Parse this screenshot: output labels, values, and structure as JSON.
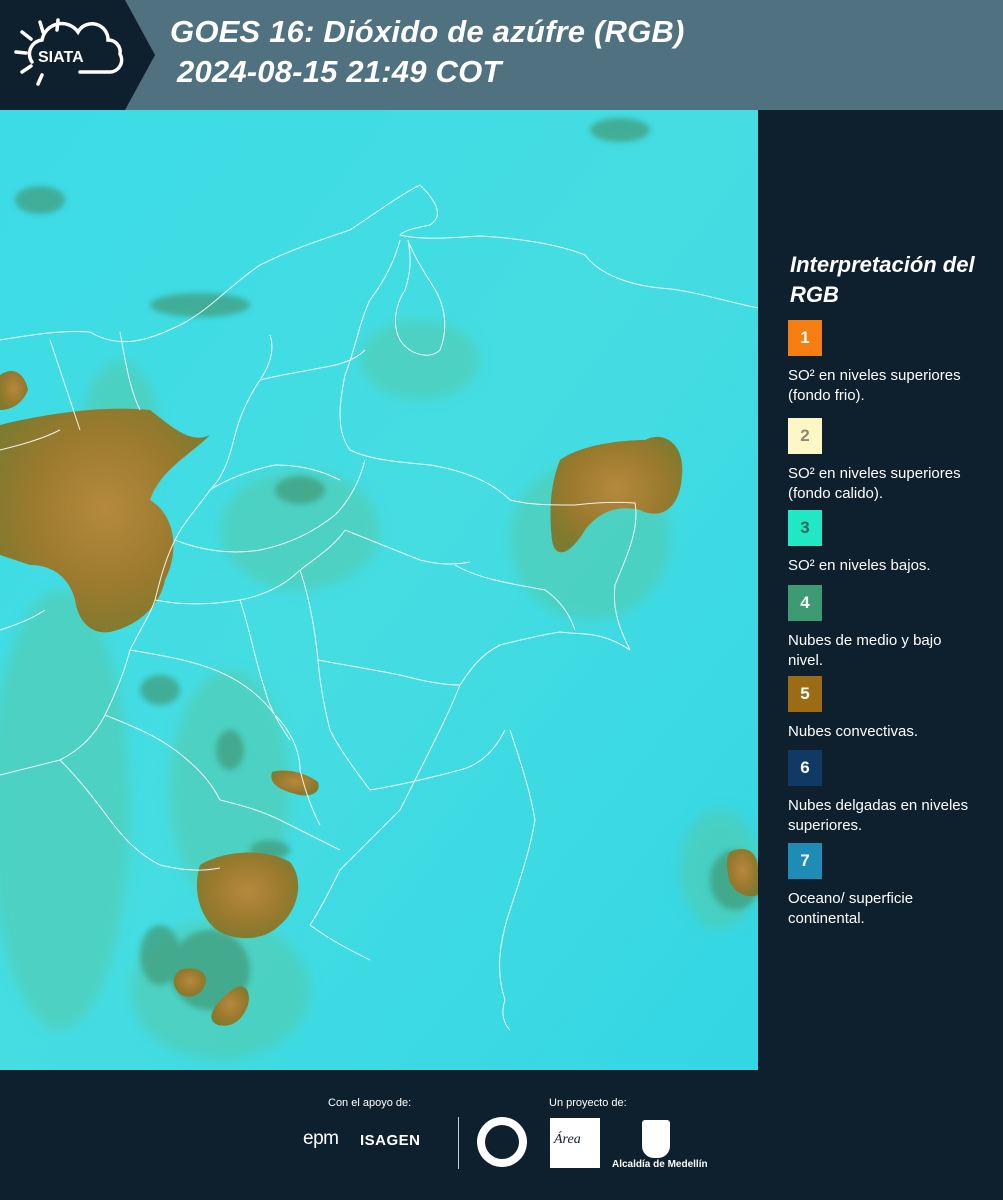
{
  "header": {
    "logo_text": "SIATA",
    "title": "GOES 16: Dióxido de azúfre (RGB)",
    "datetime": "2024-08-15 21:49 COT"
  },
  "colors": {
    "header_bg": "#4f7180",
    "panel_bg": "#0e1f2e",
    "map_base": "#35dbe6",
    "convective": "#9c7a2c",
    "low_mid_cloud": "#3f9a78"
  },
  "legend": {
    "title": "Interpretación del RGB",
    "items": [
      {
        "number": "1",
        "color": "#f77e12",
        "number_color": "#ffffff",
        "text": "SO² en niveles superiores (fondo frio)."
      },
      {
        "number": "2",
        "color": "#fdf7c5",
        "number_color": "#8a8a74",
        "text": "SO² en niveles superiores (fondo calido)."
      },
      {
        "number": "3",
        "color": "#21e8c4",
        "number_color": "#2a6b60",
        "text": "SO² en niveles bajos."
      },
      {
        "number": "4",
        "color": "#3c9b72",
        "number_color": "#ffffff",
        "text": "Nubes de medio y bajo nivel."
      },
      {
        "number": "5",
        "color": "#9c6b16",
        "number_color": "#ffffff",
        "text": "Nubes convectivas."
      },
      {
        "number": "6",
        "color": "#103a63",
        "number_color": "#ffffff",
        "text": "Nubes delgadas en niveles superiores."
      },
      {
        "number": "7",
        "color": "#1e8cb4",
        "number_color": "#ffffff",
        "text": "Oceano/ superficie continental."
      }
    ]
  },
  "footer": {
    "support_label": "Con el apoyo de:",
    "project_label": "Un proyecto de:",
    "epm": "epm",
    "isagen": "ISAGEN",
    "area": "Área",
    "alcaldia": "Alcaldía de Medellín"
  }
}
